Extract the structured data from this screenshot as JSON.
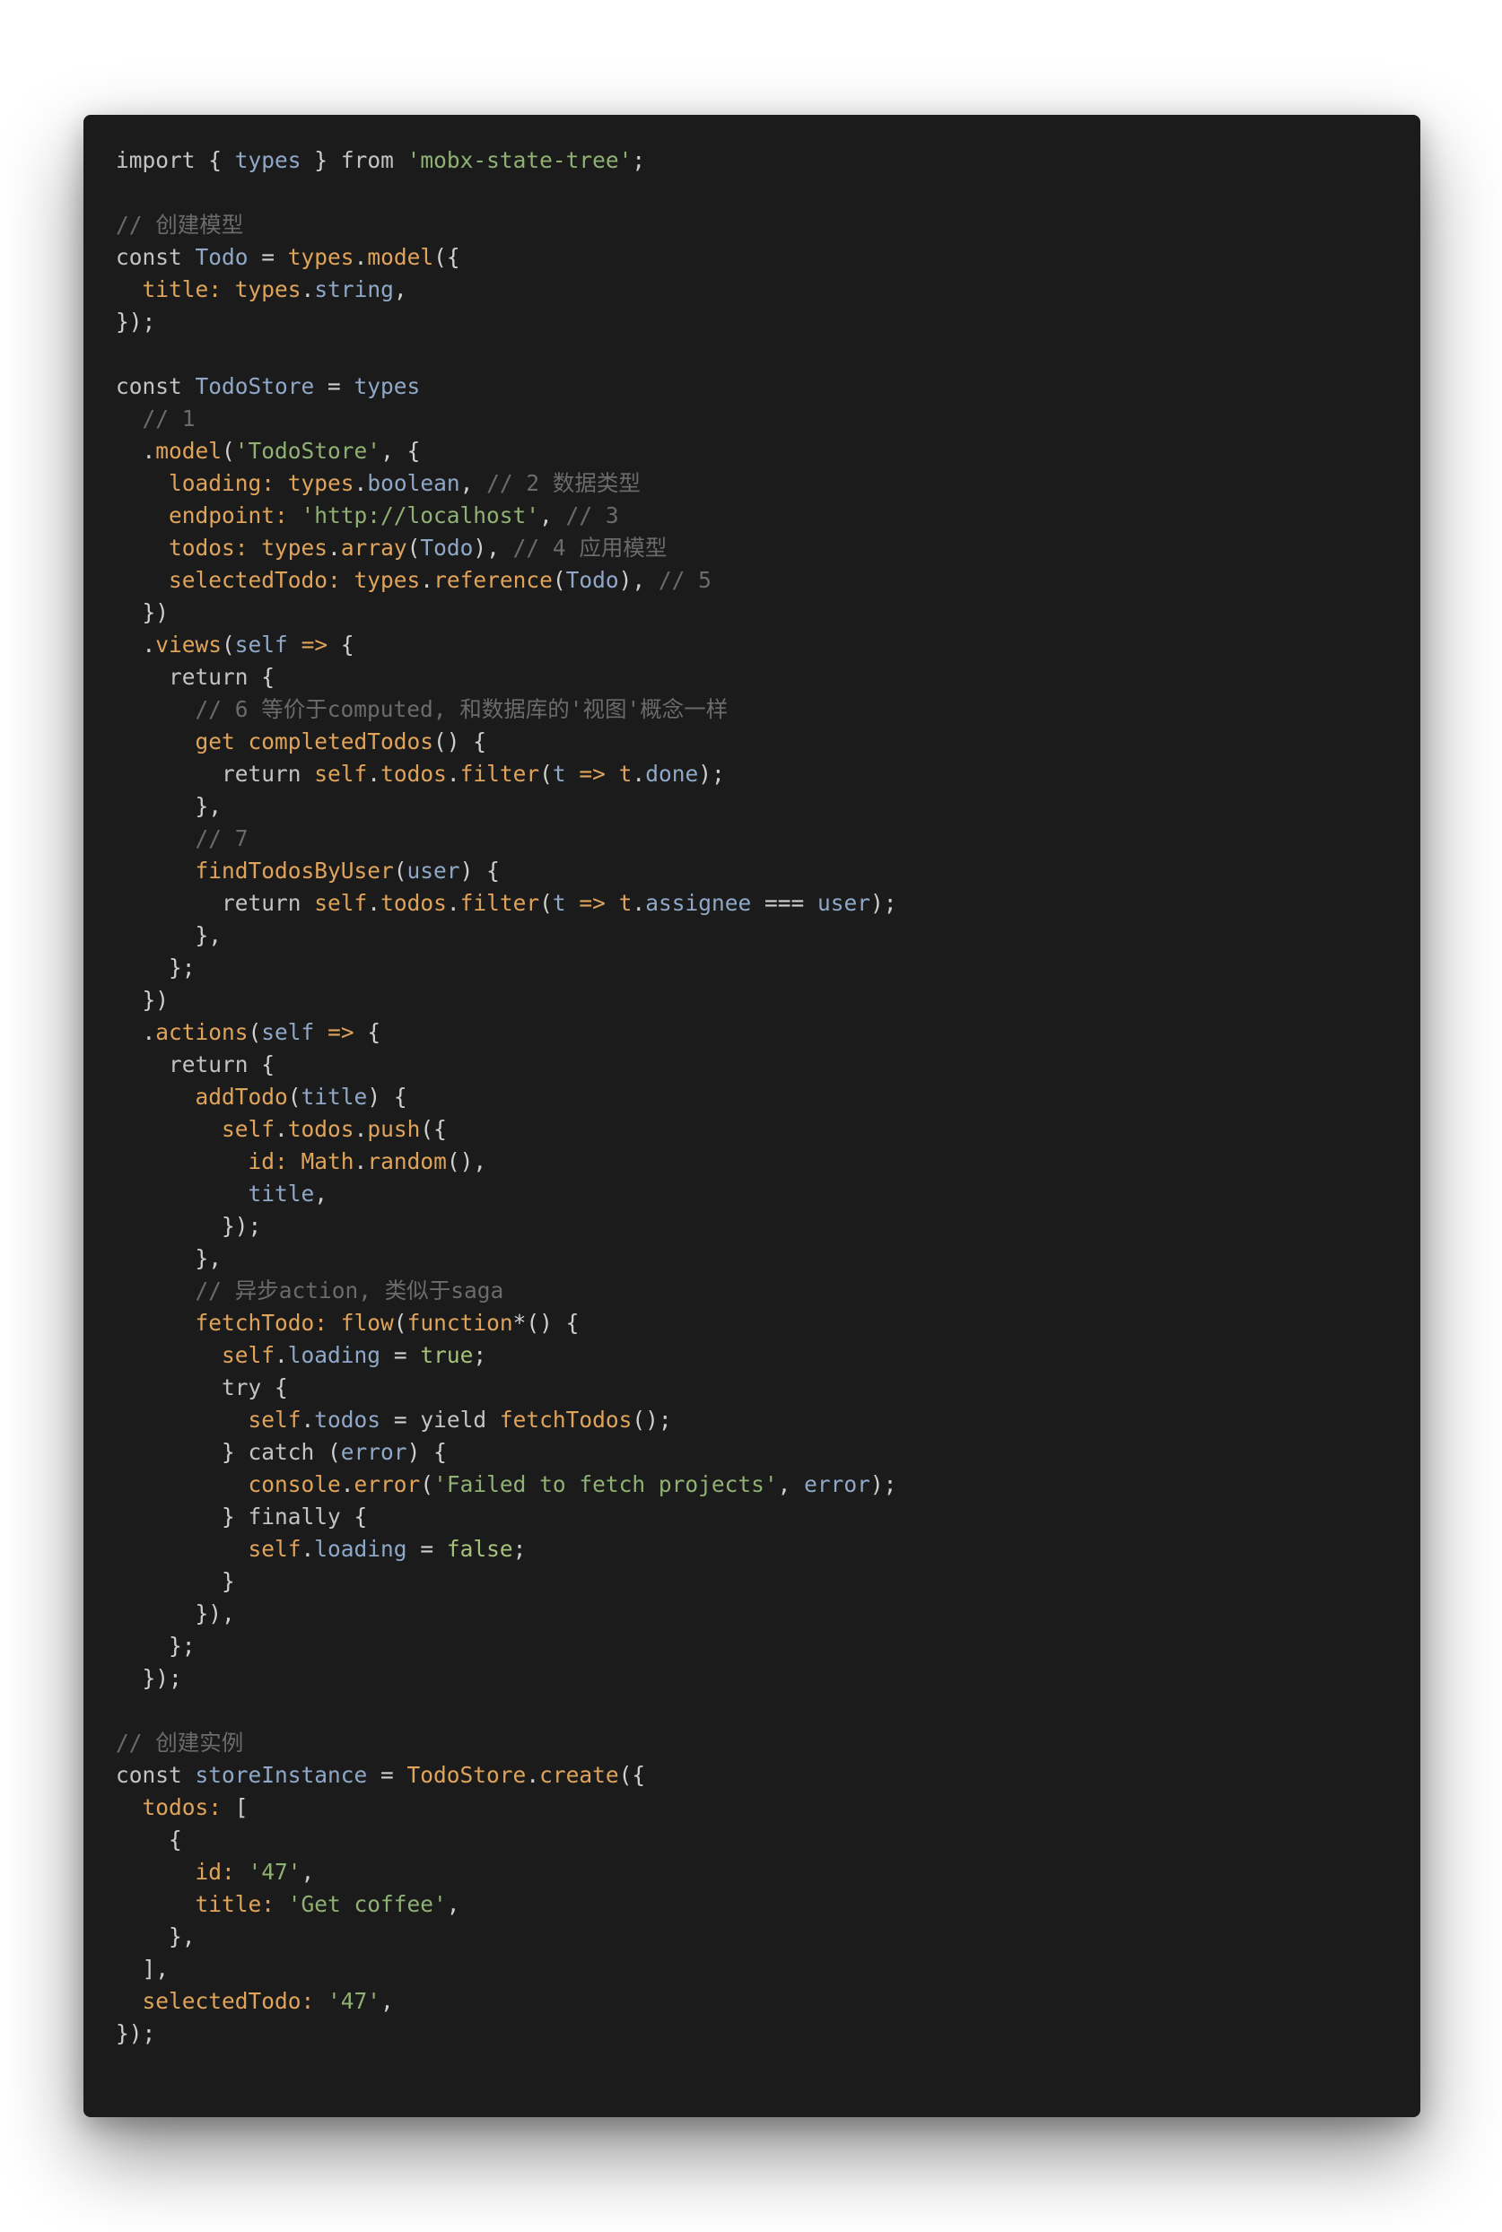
{
  "colors": {
    "page_background": "#ffffff",
    "editor_background": "#1b1b1b",
    "keyword": "#c3c3c3",
    "identifier": "#8fa8c8",
    "function": "#e0a35a",
    "string": "#8fb173",
    "comment": "#6b6b6b",
    "punctuation": "#cfcfcf"
  },
  "code_lines": [
    [
      [
        "kw",
        "import "
      ],
      [
        "pn",
        "{ "
      ],
      [
        "id",
        "types"
      ],
      [
        "pn",
        " } "
      ],
      [
        "kw",
        "from "
      ],
      [
        "str",
        "'mobx-state-tree'"
      ],
      [
        "pn",
        ";"
      ]
    ],
    [],
    [
      [
        "cm",
        "// 创建模型"
      ]
    ],
    [
      [
        "kw",
        "const "
      ],
      [
        "id",
        "Todo"
      ],
      [
        "pn",
        " = "
      ],
      [
        "fn",
        "types"
      ],
      [
        "pn",
        "."
      ],
      [
        "fn",
        "model"
      ],
      [
        "pn",
        "({"
      ]
    ],
    [
      [
        "pn",
        "  "
      ],
      [
        "prop",
        "title: "
      ],
      [
        "fn",
        "types"
      ],
      [
        "pn",
        "."
      ],
      [
        "id",
        "string"
      ],
      [
        "pn",
        ","
      ]
    ],
    [
      [
        "pn",
        "});"
      ]
    ],
    [],
    [
      [
        "kw",
        "const "
      ],
      [
        "id",
        "TodoStore"
      ],
      [
        "pn",
        " = "
      ],
      [
        "id",
        "types"
      ]
    ],
    [
      [
        "cm",
        "  // 1"
      ]
    ],
    [
      [
        "pn",
        "  ."
      ],
      [
        "fn",
        "model"
      ],
      [
        "pn",
        "("
      ],
      [
        "str",
        "'TodoStore'"
      ],
      [
        "pn",
        ", {"
      ]
    ],
    [
      [
        "pn",
        "    "
      ],
      [
        "prop",
        "loading: "
      ],
      [
        "fn",
        "types"
      ],
      [
        "pn",
        "."
      ],
      [
        "id",
        "boolean"
      ],
      [
        "pn",
        ", "
      ],
      [
        "cm",
        "// 2 数据类型"
      ]
    ],
    [
      [
        "pn",
        "    "
      ],
      [
        "prop",
        "endpoint: "
      ],
      [
        "str",
        "'http://localhost'"
      ],
      [
        "pn",
        ", "
      ],
      [
        "cm",
        "// 3"
      ]
    ],
    [
      [
        "pn",
        "    "
      ],
      [
        "prop",
        "todos: "
      ],
      [
        "fn",
        "types"
      ],
      [
        "pn",
        "."
      ],
      [
        "fn",
        "array"
      ],
      [
        "pn",
        "("
      ],
      [
        "id",
        "Todo"
      ],
      [
        "pn",
        "), "
      ],
      [
        "cm",
        "// 4 应用模型"
      ]
    ],
    [
      [
        "pn",
        "    "
      ],
      [
        "prop",
        "selectedTodo: "
      ],
      [
        "fn",
        "types"
      ],
      [
        "pn",
        "."
      ],
      [
        "fn",
        "reference"
      ],
      [
        "pn",
        "("
      ],
      [
        "id",
        "Todo"
      ],
      [
        "pn",
        "), "
      ],
      [
        "cm",
        "// 5"
      ]
    ],
    [
      [
        "pn",
        "  })"
      ]
    ],
    [
      [
        "pn",
        "  ."
      ],
      [
        "fn",
        "views"
      ],
      [
        "pn",
        "("
      ],
      [
        "id",
        "self"
      ],
      [
        "fn",
        " => "
      ],
      [
        "pn",
        "{"
      ]
    ],
    [
      [
        "pn",
        "    "
      ],
      [
        "kw",
        "return "
      ],
      [
        "pn",
        "{"
      ]
    ],
    [
      [
        "cm",
        "      // 6 等价于computed, 和数据库的'视图'概念一样"
      ]
    ],
    [
      [
        "pn",
        "      "
      ],
      [
        "fn",
        "get "
      ],
      [
        "fn",
        "completedTodos"
      ],
      [
        "pn",
        "() {"
      ]
    ],
    [
      [
        "pn",
        "        "
      ],
      [
        "kw",
        "return "
      ],
      [
        "fn",
        "self"
      ],
      [
        "pn",
        "."
      ],
      [
        "fn",
        "todos"
      ],
      [
        "pn",
        "."
      ],
      [
        "fn",
        "filter"
      ],
      [
        "pn",
        "("
      ],
      [
        "id",
        "t"
      ],
      [
        "fn",
        " => "
      ],
      [
        "fn",
        "t"
      ],
      [
        "pn",
        "."
      ],
      [
        "id",
        "done"
      ],
      [
        "pn",
        ");"
      ]
    ],
    [
      [
        "pn",
        "      },"
      ]
    ],
    [
      [
        "cm",
        "      // 7"
      ]
    ],
    [
      [
        "pn",
        "      "
      ],
      [
        "fn",
        "findTodosByUser"
      ],
      [
        "pn",
        "("
      ],
      [
        "id",
        "user"
      ],
      [
        "pn",
        ") {"
      ]
    ],
    [
      [
        "pn",
        "        "
      ],
      [
        "kw",
        "return "
      ],
      [
        "fn",
        "self"
      ],
      [
        "pn",
        "."
      ],
      [
        "fn",
        "todos"
      ],
      [
        "pn",
        "."
      ],
      [
        "fn",
        "filter"
      ],
      [
        "pn",
        "("
      ],
      [
        "id",
        "t"
      ],
      [
        "fn",
        " => "
      ],
      [
        "fn",
        "t"
      ],
      [
        "pn",
        "."
      ],
      [
        "id",
        "assignee"
      ],
      [
        "pn",
        " === "
      ],
      [
        "id",
        "user"
      ],
      [
        "pn",
        ");"
      ]
    ],
    [
      [
        "pn",
        "      },"
      ]
    ],
    [
      [
        "pn",
        "    };"
      ]
    ],
    [
      [
        "pn",
        "  })"
      ]
    ],
    [
      [
        "pn",
        "  ."
      ],
      [
        "fn",
        "actions"
      ],
      [
        "pn",
        "("
      ],
      [
        "id",
        "self"
      ],
      [
        "fn",
        " => "
      ],
      [
        "pn",
        "{"
      ]
    ],
    [
      [
        "pn",
        "    "
      ],
      [
        "kw",
        "return "
      ],
      [
        "pn",
        "{"
      ]
    ],
    [
      [
        "pn",
        "      "
      ],
      [
        "fn",
        "addTodo"
      ],
      [
        "pn",
        "("
      ],
      [
        "id",
        "title"
      ],
      [
        "pn",
        ") {"
      ]
    ],
    [
      [
        "pn",
        "        "
      ],
      [
        "fn",
        "self"
      ],
      [
        "pn",
        "."
      ],
      [
        "fn",
        "todos"
      ],
      [
        "pn",
        "."
      ],
      [
        "fn",
        "push"
      ],
      [
        "pn",
        "({"
      ]
    ],
    [
      [
        "pn",
        "          "
      ],
      [
        "prop",
        "id: "
      ],
      [
        "fn",
        "Math"
      ],
      [
        "pn",
        "."
      ],
      [
        "fn",
        "random"
      ],
      [
        "pn",
        "(),"
      ]
    ],
    [
      [
        "pn",
        "          "
      ],
      [
        "id",
        "title"
      ],
      [
        "pn",
        ","
      ]
    ],
    [
      [
        "pn",
        "        });"
      ]
    ],
    [
      [
        "pn",
        "      },"
      ]
    ],
    [
      [
        "cm",
        "      // 异步action, 类似于saga"
      ]
    ],
    [
      [
        "pn",
        "      "
      ],
      [
        "prop",
        "fetchTodo: "
      ],
      [
        "fn",
        "flow"
      ],
      [
        "pn",
        "("
      ],
      [
        "fn",
        "function"
      ],
      [
        "pn",
        "*() {"
      ]
    ],
    [
      [
        "pn",
        "        "
      ],
      [
        "fn",
        "self"
      ],
      [
        "pn",
        "."
      ],
      [
        "id",
        "loading"
      ],
      [
        "pn",
        " = "
      ],
      [
        "lit",
        "true"
      ],
      [
        "pn",
        ";"
      ]
    ],
    [
      [
        "pn",
        "        "
      ],
      [
        "kw",
        "try "
      ],
      [
        "pn",
        "{"
      ]
    ],
    [
      [
        "pn",
        "          "
      ],
      [
        "fn",
        "self"
      ],
      [
        "pn",
        "."
      ],
      [
        "id",
        "todos"
      ],
      [
        "pn",
        " = "
      ],
      [
        "kw",
        "yield "
      ],
      [
        "fn",
        "fetchTodos"
      ],
      [
        "pn",
        "();"
      ]
    ],
    [
      [
        "pn",
        "        } "
      ],
      [
        "kw",
        "catch "
      ],
      [
        "pn",
        "("
      ],
      [
        "id",
        "error"
      ],
      [
        "pn",
        ") {"
      ]
    ],
    [
      [
        "pn",
        "          "
      ],
      [
        "fn",
        "console"
      ],
      [
        "pn",
        "."
      ],
      [
        "fn",
        "error"
      ],
      [
        "pn",
        "("
      ],
      [
        "str",
        "'Failed to fetch projects'"
      ],
      [
        "pn",
        ", "
      ],
      [
        "id",
        "error"
      ],
      [
        "pn",
        ");"
      ]
    ],
    [
      [
        "pn",
        "        } "
      ],
      [
        "kw",
        "finally "
      ],
      [
        "pn",
        "{"
      ]
    ],
    [
      [
        "pn",
        "          "
      ],
      [
        "fn",
        "self"
      ],
      [
        "pn",
        "."
      ],
      [
        "id",
        "loading"
      ],
      [
        "pn",
        " = "
      ],
      [
        "lit",
        "false"
      ],
      [
        "pn",
        ";"
      ]
    ],
    [
      [
        "pn",
        "        }"
      ]
    ],
    [
      [
        "pn",
        "      }),"
      ]
    ],
    [
      [
        "pn",
        "    };"
      ]
    ],
    [
      [
        "pn",
        "  });"
      ]
    ],
    [],
    [
      [
        "cm",
        "// 创建实例"
      ]
    ],
    [
      [
        "kw",
        "const "
      ],
      [
        "id",
        "storeInstance"
      ],
      [
        "pn",
        " = "
      ],
      [
        "fn",
        "TodoStore"
      ],
      [
        "pn",
        "."
      ],
      [
        "fn",
        "create"
      ],
      [
        "pn",
        "({"
      ]
    ],
    [
      [
        "pn",
        "  "
      ],
      [
        "prop",
        "todos: "
      ],
      [
        "pn",
        "["
      ]
    ],
    [
      [
        "pn",
        "    {"
      ]
    ],
    [
      [
        "pn",
        "      "
      ],
      [
        "prop",
        "id: "
      ],
      [
        "str",
        "'47'"
      ],
      [
        "pn",
        ","
      ]
    ],
    [
      [
        "pn",
        "      "
      ],
      [
        "prop",
        "title: "
      ],
      [
        "str",
        "'Get coffee'"
      ],
      [
        "pn",
        ","
      ]
    ],
    [
      [
        "pn",
        "    },"
      ]
    ],
    [
      [
        "pn",
        "  ],"
      ]
    ],
    [
      [
        "pn",
        "  "
      ],
      [
        "prop",
        "selectedTodo: "
      ],
      [
        "str",
        "'47'"
      ],
      [
        "pn",
        ","
      ]
    ],
    [
      [
        "pn",
        "});"
      ]
    ]
  ]
}
